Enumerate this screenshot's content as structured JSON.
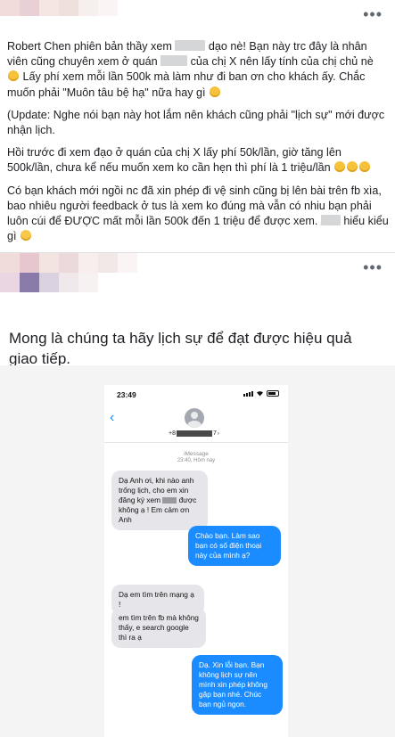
{
  "post": {
    "more_label": "•••",
    "para1_a": "Robert Chen phiên bản thầy xem",
    "para1_b": "dạo nè! Bạn này trc đây là nhân viên cũng chuyên xem ở quán",
    "para1_c": "của chị X nên lấy tính của chị chủ nè",
    "para1_d": "Lấy phí xem mỗi lần 500k mà làm như đi ban ơn cho khách ấy. Chắc muốn phải \"Muôn tâu bệ hạ\" nữa hay gì",
    "para2": "(Update: Nghe nói bạn này hot lắm nên khách cũng phải \"lịch sự\" mới được nhận lịch.",
    "para3": "Hồi trước đi xem đạo ở quán của chị X lấy phí 50k/lần, giờ tăng lên 500k/lần, chưa kể nếu muốn xem ko cần hẹn thì phí là 1 triệu/lần",
    "para4_a": "Có bạn khách mới ngồi nc đã xin phép đi vệ sinh cũng bị lên bài trên fb xìa, bao nhiêu người feedback ở tus là xem ko đúng mà vẫn có nhiu bạn phải luôn cúi để ĐƯỢC mất mỗi lần 500k đến 1 triệu để được xem.",
    "para4_b": "hiểu kiểu gì"
  },
  "shared": {
    "caption": "Mong là chúng ta hãy lịch sự để đạt được hiệu quả giao tiếp."
  },
  "phone": {
    "time": "23:49",
    "number_prefix": "+8",
    "number_suffix": "7",
    "service": "iMessage",
    "timestamp": "23:40, Hôm nay",
    "messages": [
      {
        "dir": "in",
        "text_a": "Dạ Anh ơi, khi nào anh trống lịch, cho em xin đăng ký xem",
        "text_b": "được không ạ ! Em cảm ơn Anh"
      },
      {
        "dir": "out",
        "text": "Chào bạn. Làm sao bạn có số điện thoại này của mình ạ?"
      },
      {
        "dir": "in",
        "text": "Dạ em tìm trên mạng ạ !"
      },
      {
        "dir": "in",
        "text": "em tìm trên fb mà không thấy, e search google thì ra ạ"
      },
      {
        "dir": "out",
        "text": "Dạ. Xin lỗi bạn. Bạn không lịch sự nên mình xin phép không gặp bạn nhé. Chúc bạn ngủ ngon."
      }
    ]
  },
  "colors": {
    "imessage_blue": "#1a8cff",
    "bubble_gray": "#e5e5ea",
    "text": "#1c1e21",
    "divider": "#dddfe2"
  }
}
